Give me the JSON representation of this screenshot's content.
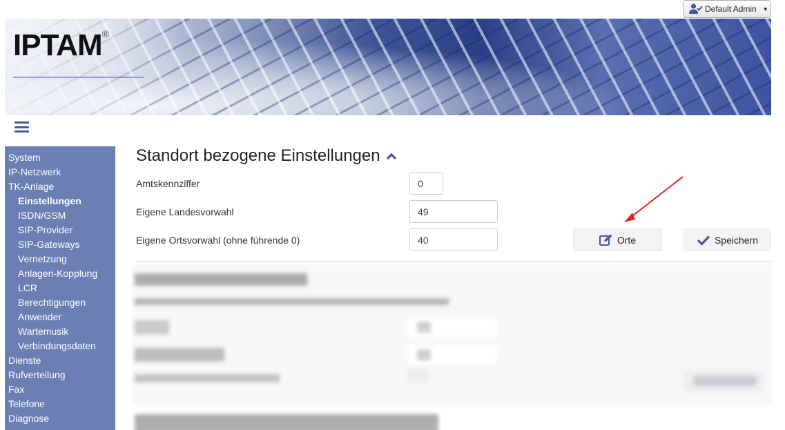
{
  "header": {
    "user_menu_label": "Default Admin",
    "logo_text": "IPTAM",
    "logo_mark": "®"
  },
  "sidebar": {
    "items": [
      {
        "label": "System",
        "level": 0,
        "active": false
      },
      {
        "label": "IP-Netzwerk",
        "level": 0,
        "active": false
      },
      {
        "label": "TK-Anlage",
        "level": 0,
        "active": false
      },
      {
        "label": "Einstellungen",
        "level": 1,
        "active": true
      },
      {
        "label": "ISDN/GSM",
        "level": 1,
        "active": false
      },
      {
        "label": "SIP-Provider",
        "level": 1,
        "active": false
      },
      {
        "label": "SIP-Gateways",
        "level": 1,
        "active": false
      },
      {
        "label": "Vernetzung",
        "level": 1,
        "active": false
      },
      {
        "label": "Anlagen-Kopplung",
        "level": 1,
        "active": false
      },
      {
        "label": "LCR",
        "level": 1,
        "active": false
      },
      {
        "label": "Berechtigungen",
        "level": 1,
        "active": false
      },
      {
        "label": "Anwender",
        "level": 1,
        "active": false
      },
      {
        "label": "Wartemusik",
        "level": 1,
        "active": false
      },
      {
        "label": "Verbindungsdaten",
        "level": 1,
        "active": false
      },
      {
        "label": "Dienste",
        "level": 0,
        "active": false
      },
      {
        "label": "Rufverteilung",
        "level": 0,
        "active": false
      },
      {
        "label": "Fax",
        "level": 0,
        "active": false
      },
      {
        "label": "Telefone",
        "level": 0,
        "active": false
      },
      {
        "label": "Diagnose",
        "level": 0,
        "active": false
      }
    ]
  },
  "section": {
    "title": "Standort bezogene Einstellungen",
    "fields": [
      {
        "label": "Amtskennziffer",
        "value": "0"
      },
      {
        "label": "Eigene Landesvorwahl",
        "value": "49"
      },
      {
        "label": "Eigene Ortsvorwahl (ohne führende 0)",
        "value": "40"
      }
    ],
    "orte_button": "Orte",
    "save_button": "Speichern"
  },
  "colors": {
    "sidebar_bg": "#6b7fb5",
    "accent": "#3f5a96",
    "arrow": "#e02020"
  }
}
